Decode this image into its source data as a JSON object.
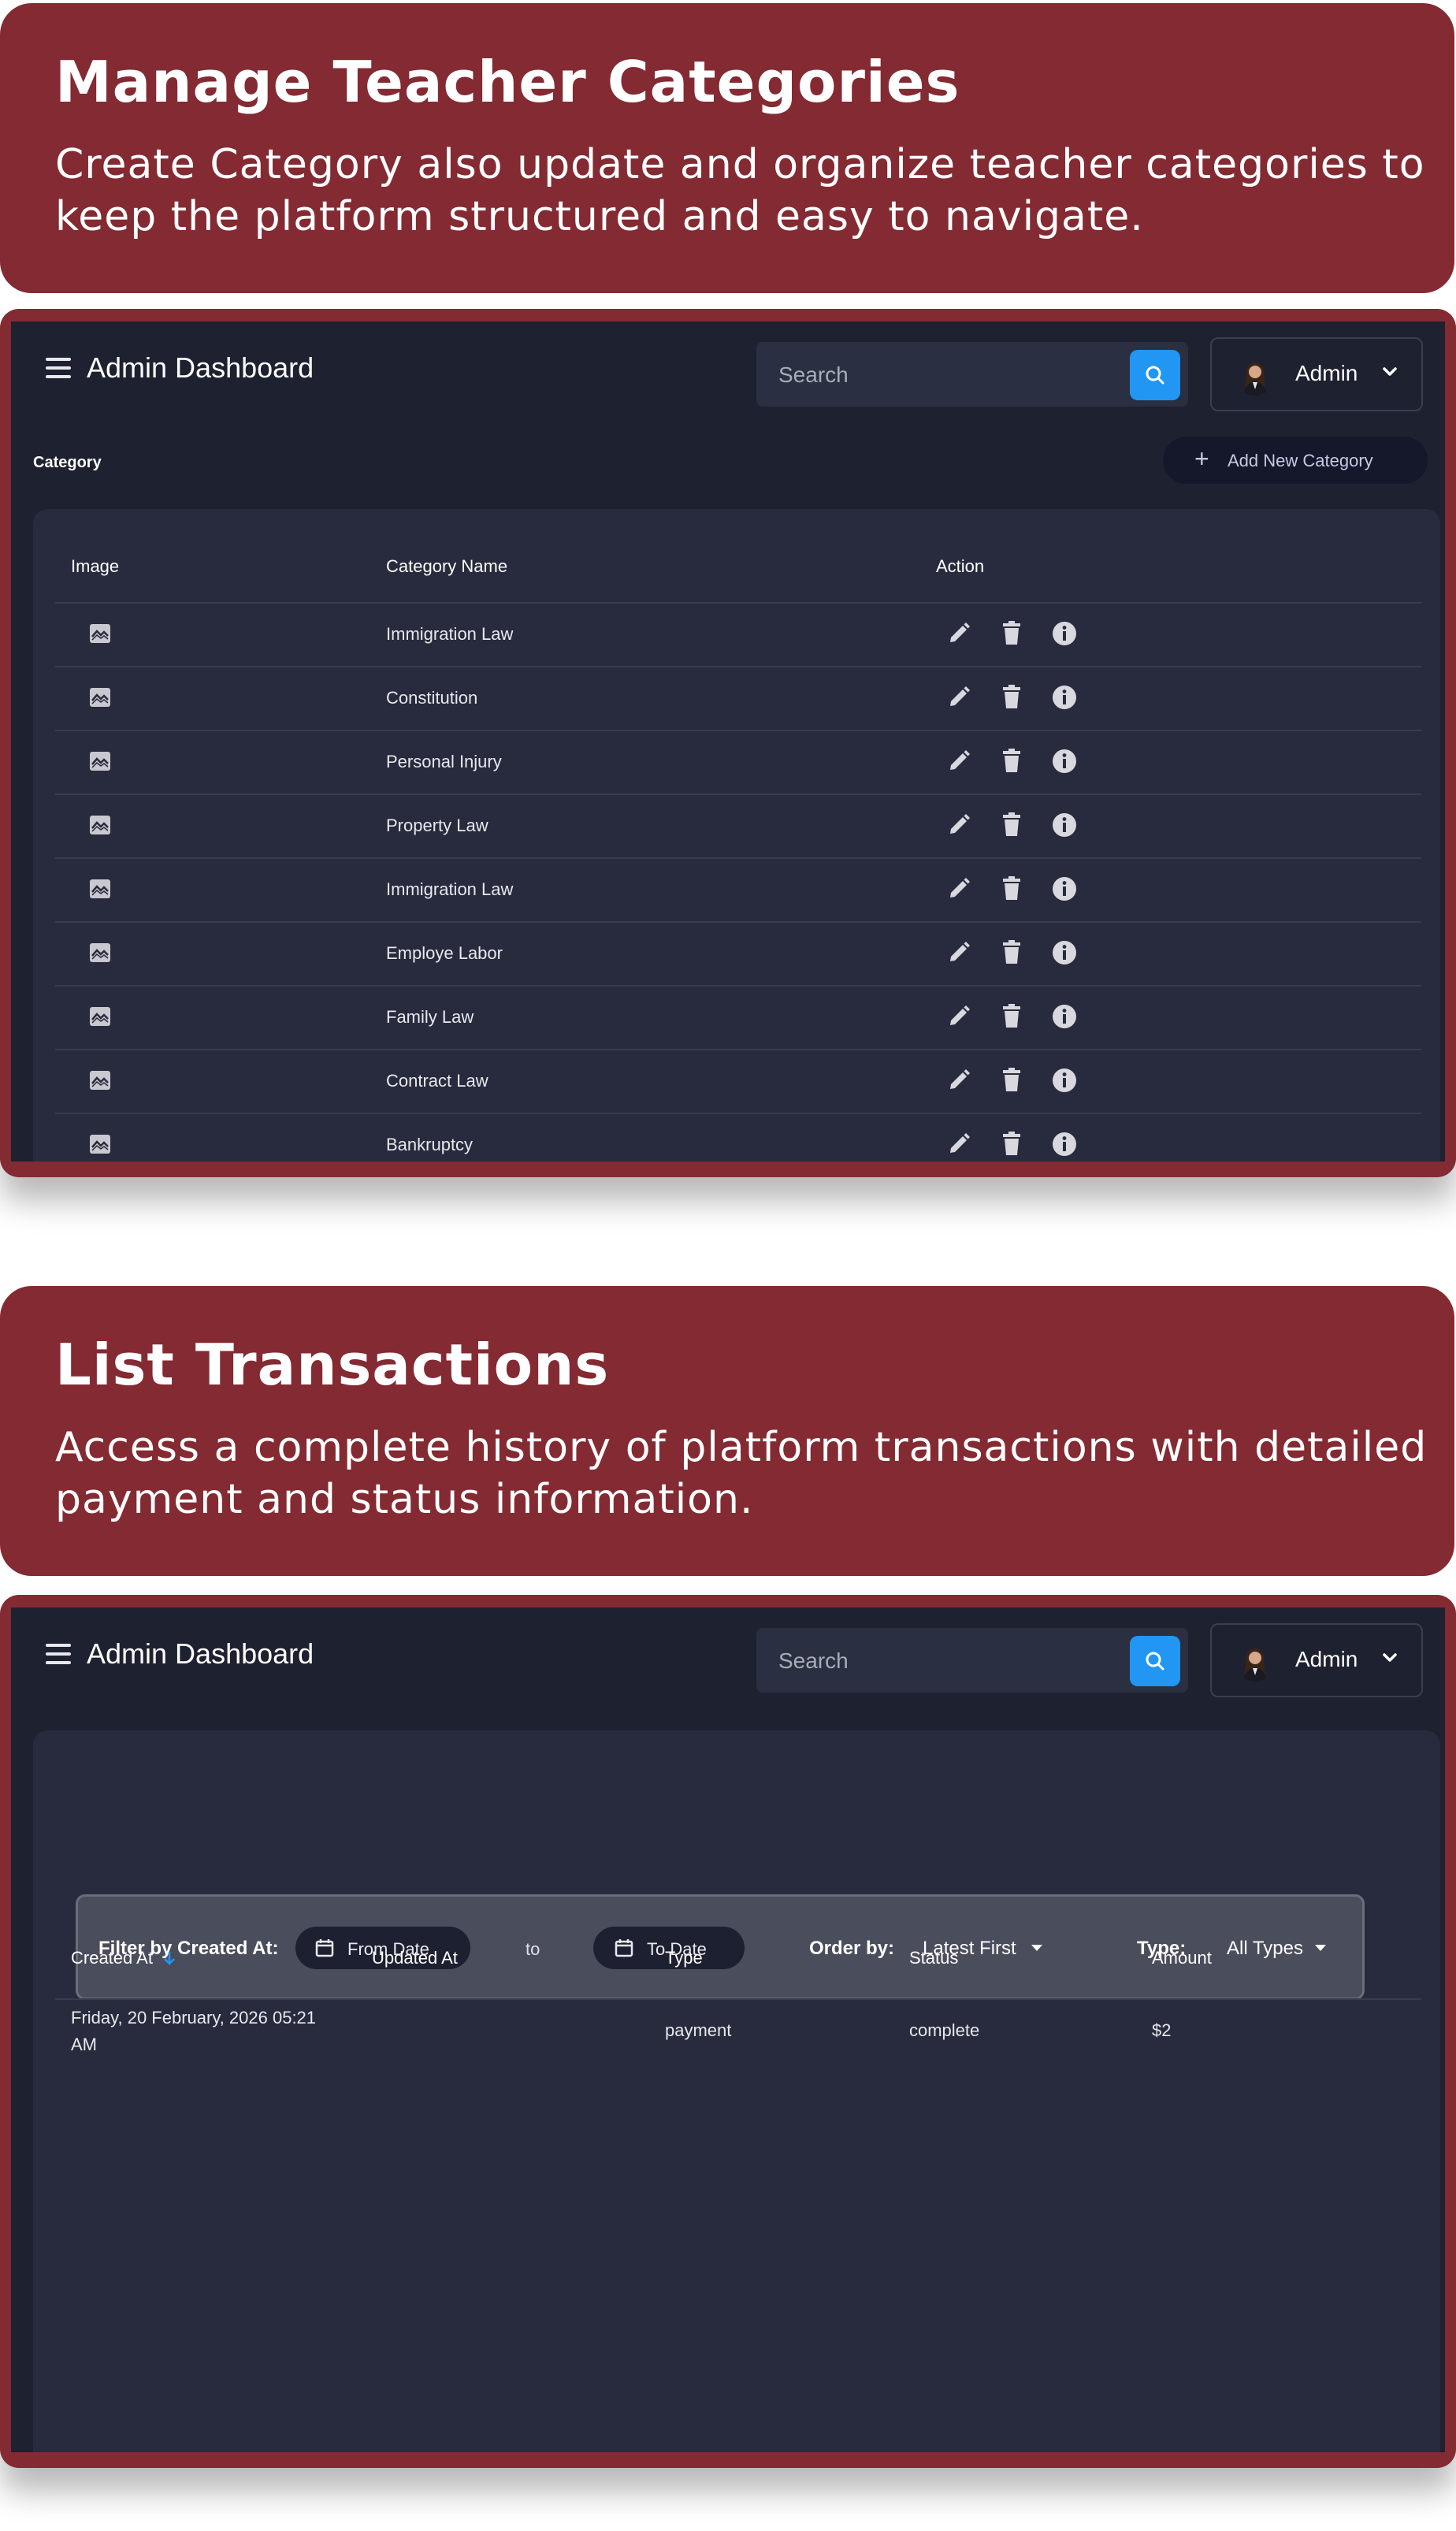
{
  "section1": {
    "title": "Manage Teacher Categories",
    "description_line1": "Create Category also update and organize teacher categories to",
    "description_line2": "keep the platform structured and easy to navigate."
  },
  "section2": {
    "title": "List Transactions",
    "description_line1": "Access a complete history of platform transactions with detailed",
    "description_line2": "payment and status information."
  },
  "dashboard": {
    "title": "Admin Dashboard",
    "search_placeholder": "Search",
    "user_label": "Admin"
  },
  "categories": {
    "breadcrumb": "Category",
    "add_button": "Add New Category",
    "columns": [
      "Image",
      "Category Name",
      "Action"
    ],
    "rows": [
      "Immigration Law",
      "Constitution",
      "Personal Injury",
      "Property Law",
      "Immigration Law",
      "Employe Labor",
      "Family Law",
      "Contract Law",
      "Bankruptcy"
    ]
  },
  "transactions": {
    "filter_label": "Filter by Created At:",
    "from_date": "From Date",
    "to_label": "to",
    "to_date": "To Date",
    "order_label": "Order by:",
    "order_value": "Latest First",
    "type_label": "Type:",
    "type_value": "All Types",
    "columns": [
      "Created At",
      "Updated At",
      "Type",
      "Status",
      "Amount"
    ],
    "rows": [
      {
        "created_at_line1": "Friday, 20 February, 2026 05:21",
        "created_at_line2": "AM",
        "updated_at": "",
        "type": "payment",
        "status": "complete",
        "amount": "$2"
      }
    ]
  },
  "colors": {
    "banner": "#842a32",
    "screen_bg": "#1e2130",
    "panel_bg": "#272b3d",
    "accent_blue": "#2196f3"
  }
}
